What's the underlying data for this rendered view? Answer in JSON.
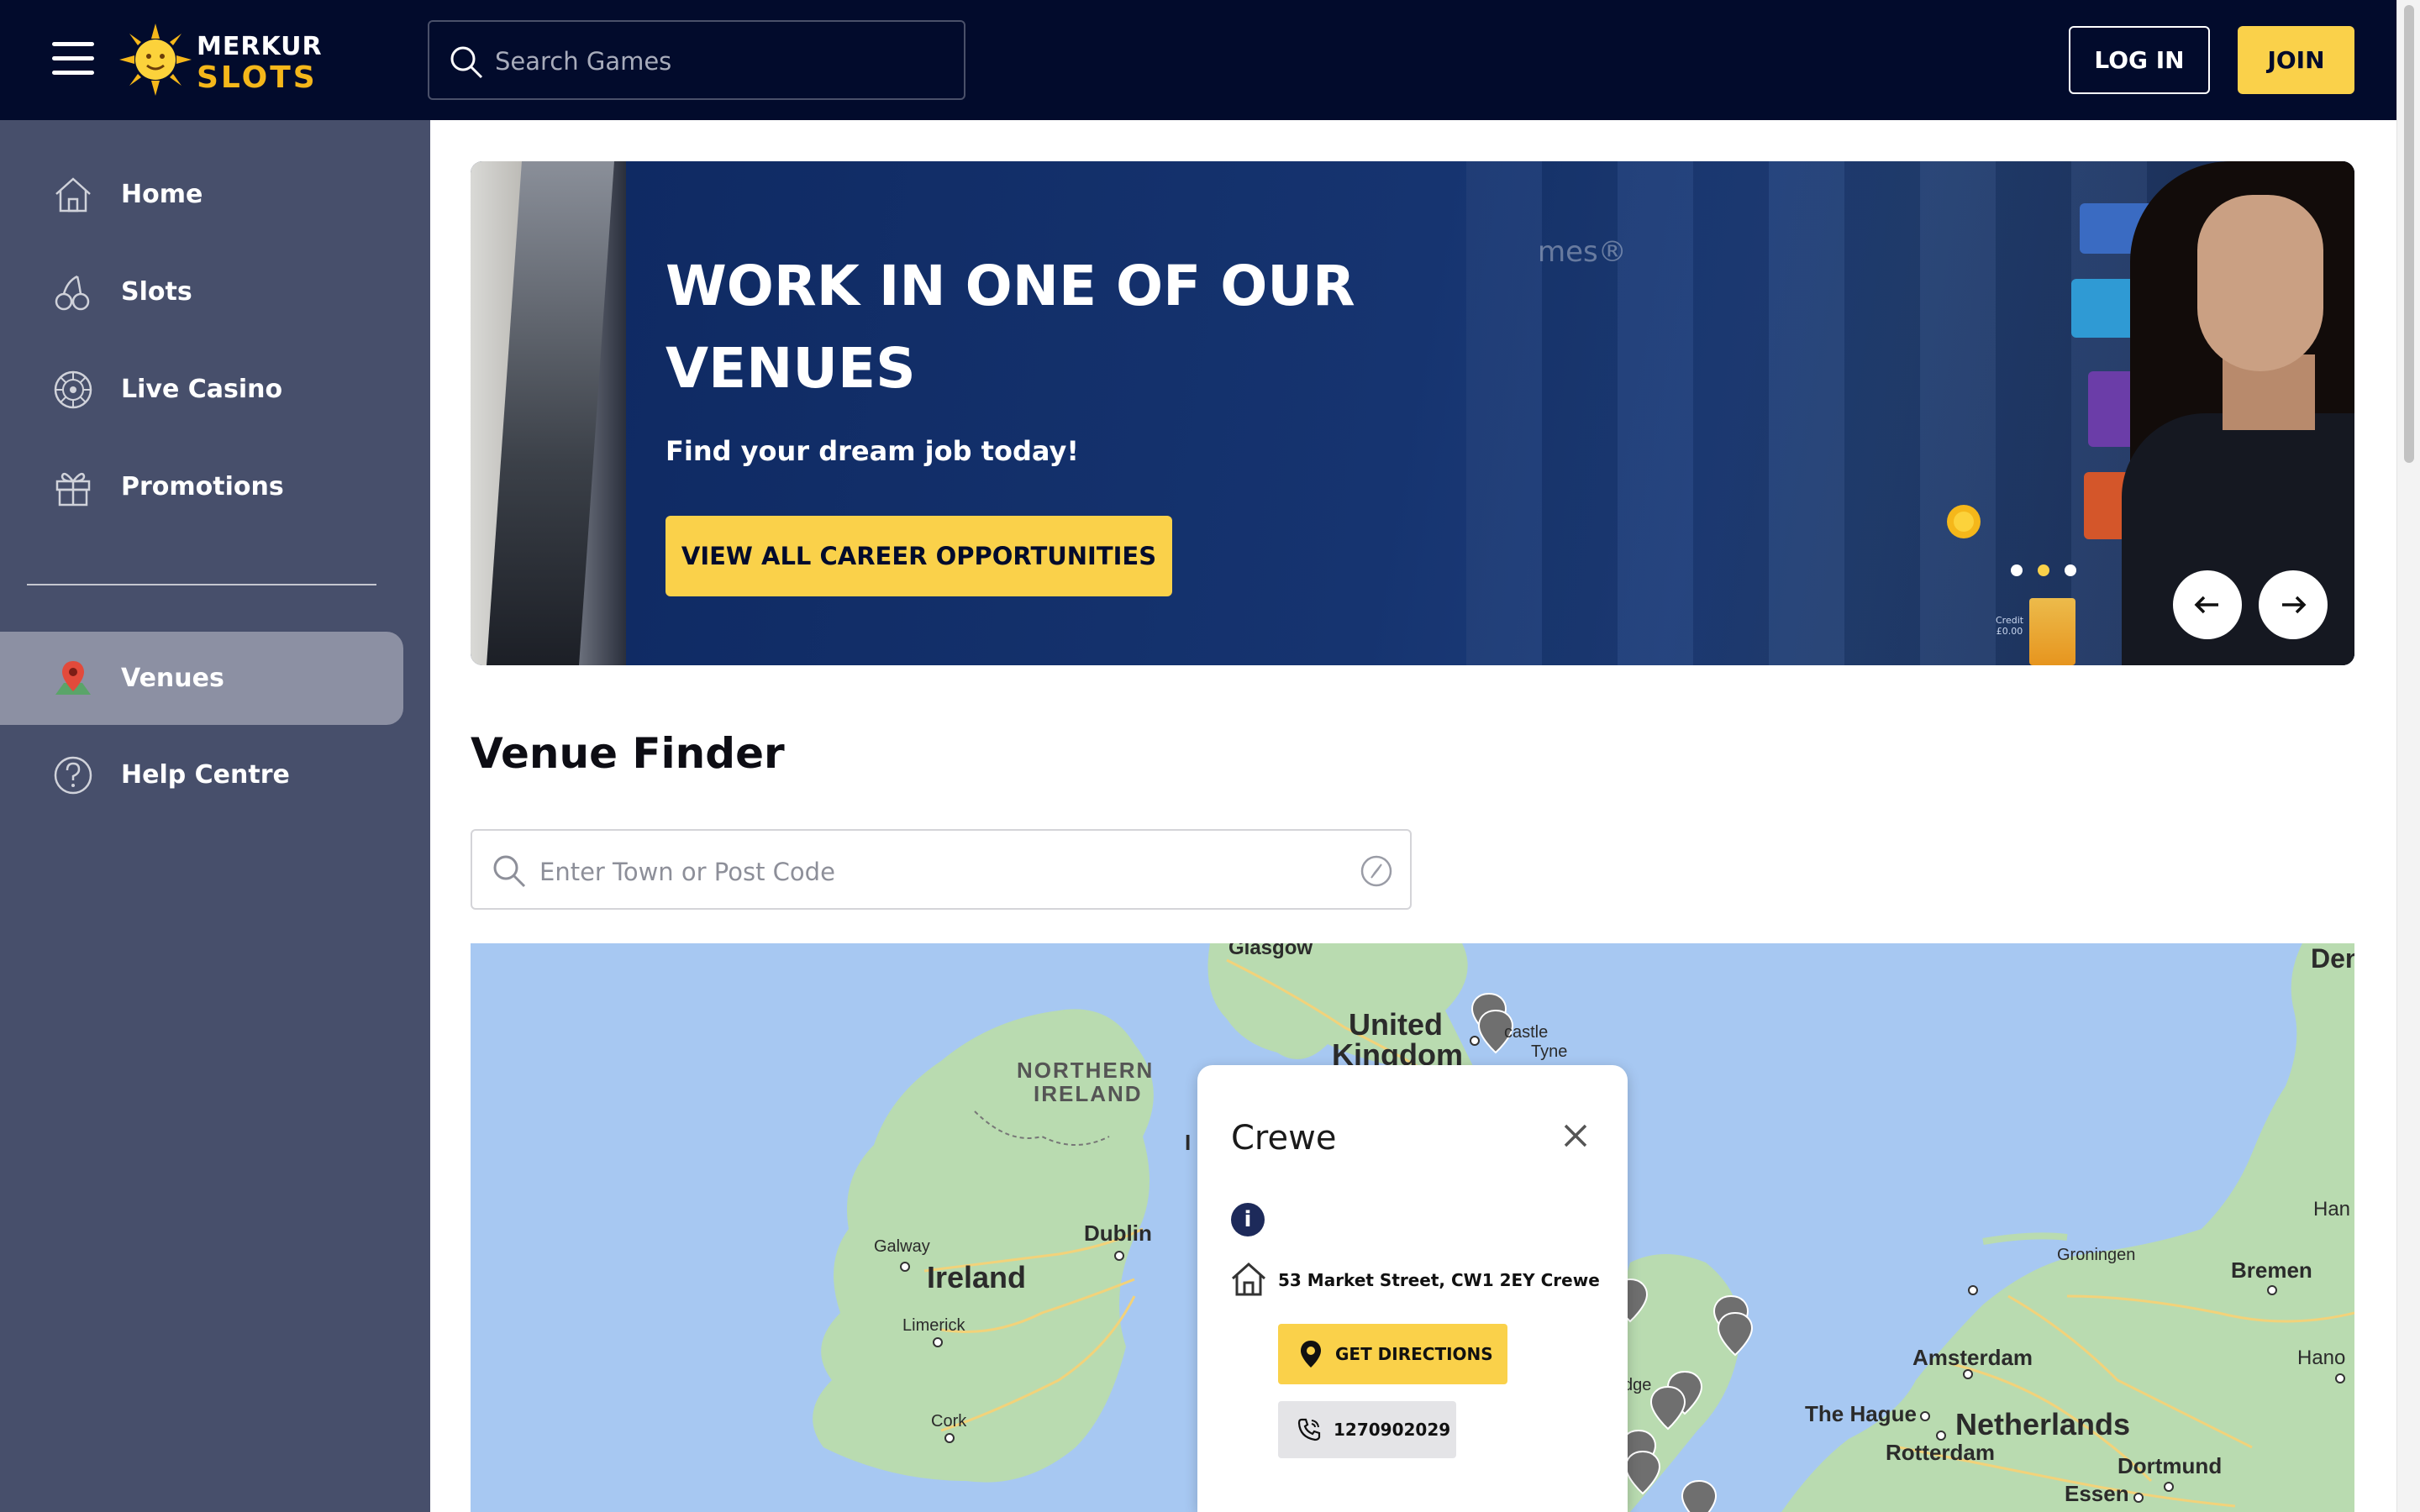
{
  "header": {
    "logo_line1": "MERKUR",
    "logo_line2": "SLOTS",
    "search_placeholder": "Search Games",
    "login_label": "LOG IN",
    "join_label": "JOIN"
  },
  "sidebar": {
    "items": [
      {
        "label": "Home",
        "icon": "home-icon"
      },
      {
        "label": "Slots",
        "icon": "cherries-icon"
      },
      {
        "label": "Live Casino",
        "icon": "roulette-wheel-icon"
      },
      {
        "label": "Promotions",
        "icon": "gift-icon"
      },
      {
        "label": "Venues",
        "icon": "map-pin-icon",
        "active": true
      },
      {
        "label": "Help Centre",
        "icon": "question-icon"
      }
    ]
  },
  "banner": {
    "title": "WORK IN ONE OF OUR VENUES",
    "subtitle": "Find your dream job today!",
    "cta_label": "VIEW ALL CAREER OPPORTUNITIES",
    "slide_count": 3,
    "active_slide": 2,
    "machine_text": "mes®",
    "credit_label": "Credit",
    "credit_value": "£0.00"
  },
  "venue_finder": {
    "title": "Venue Finder",
    "search_placeholder": "Enter Town or Post Code"
  },
  "map": {
    "labels": {
      "glasgow": "Glasgow",
      "uk1": "United",
      "uk2": "Kingdom",
      "newcastle1": "castle",
      "newcastle2": "Tyne",
      "ni1": "NORTHERN",
      "ni2": "IRELAND",
      "dublin": "Dublin",
      "galway": "Galway",
      "ireland": "Ireland",
      "limerick": "Limerick",
      "cork": "Cork",
      "dge": "dge",
      "den": "Den",
      "han": "Han",
      "groningen": "Groningen",
      "bremen": "Bremen",
      "amsterdam": "Amsterdam",
      "hano": "Hano",
      "hague": "The Hague",
      "netherlands": "Netherlands",
      "rotterdam": "Rotterdam",
      "dortmund": "Dortmund",
      "essen": "Essen",
      "i": "I"
    }
  },
  "popup": {
    "title": "Crewe",
    "address": "53 Market Street, CW1 2EY Crewe",
    "directions_label": "GET DIRECTIONS",
    "phone": "1270902029"
  },
  "colors": {
    "header_bg": "#020b2c",
    "sidebar_bg": "#474f6b",
    "accent_yellow": "#fad14a",
    "banner_bg": "#16295a",
    "map_water": "#a7c8f2",
    "map_land": "#b9dbb0"
  }
}
